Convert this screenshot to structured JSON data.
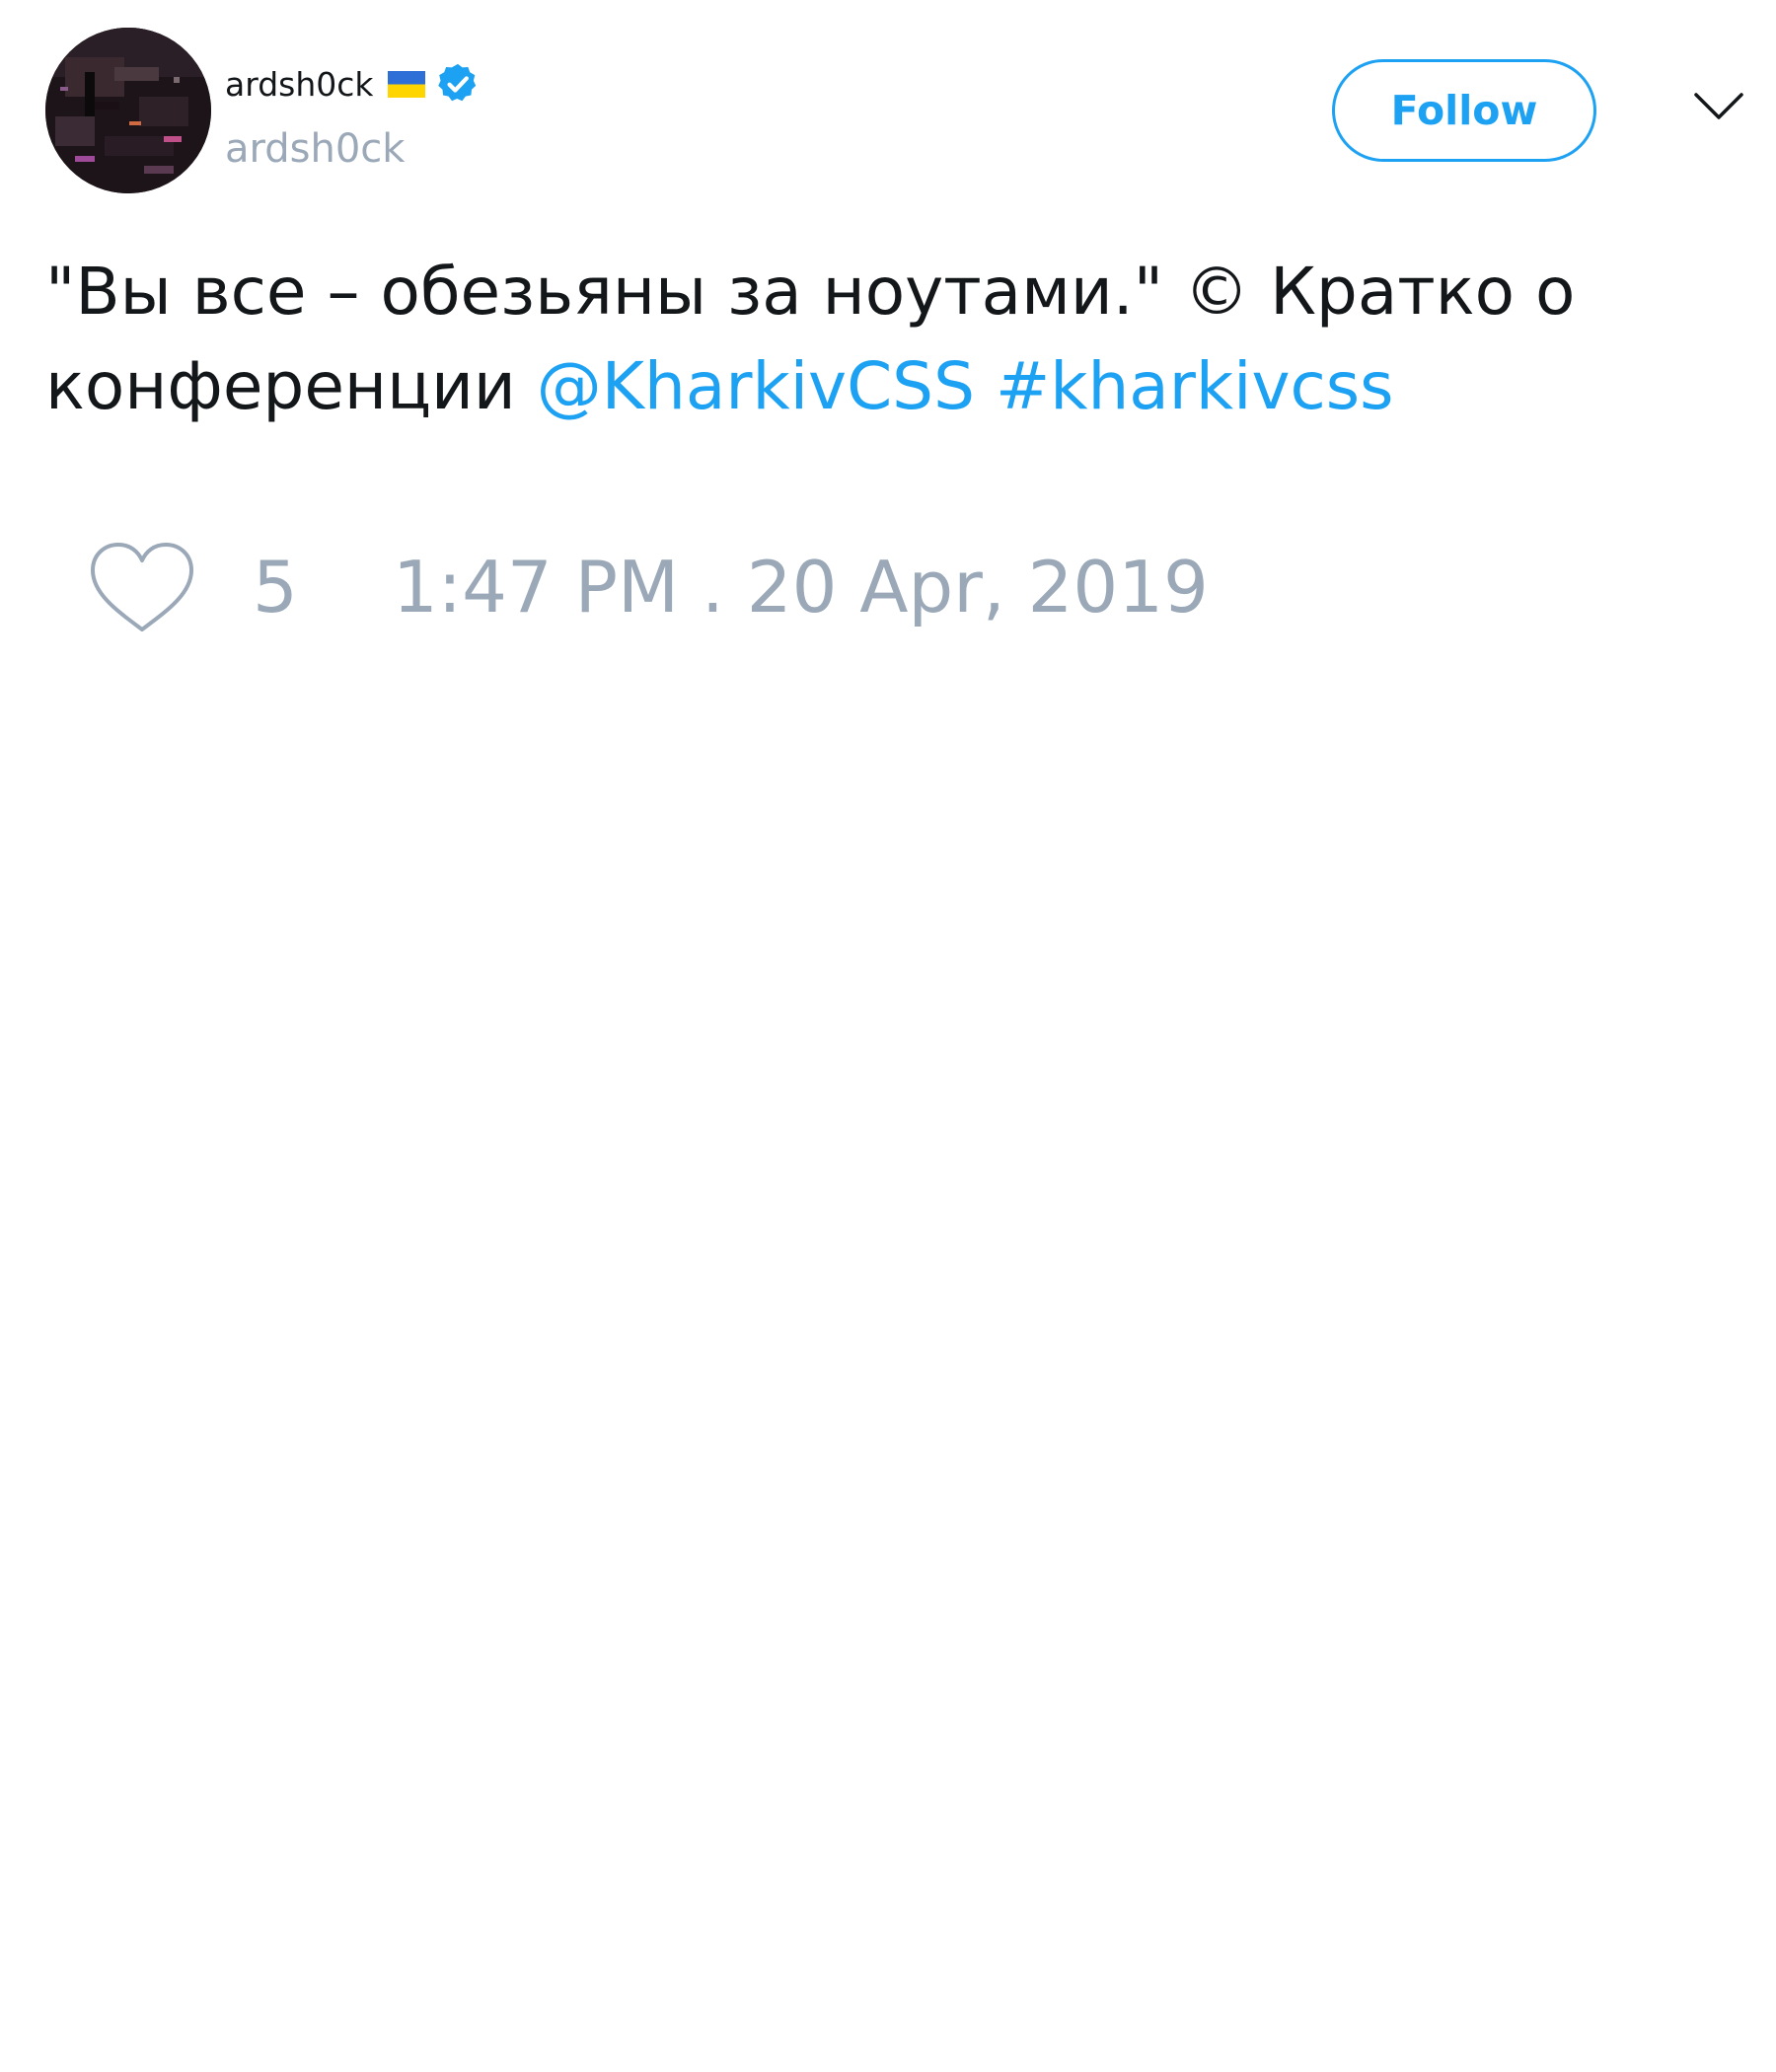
{
  "author": {
    "display_name": "ardsh0ck",
    "handle": "ardsh0ck",
    "flag": "🇺🇦",
    "flag_icon": "ukraine-flag-icon",
    "verified_icon": "verified-badge-icon",
    "avatar": "profile-photo"
  },
  "actions": {
    "follow_label": "Follow",
    "menu_icon": "chevron-down-icon"
  },
  "tweet": {
    "text_before": "\"Вы все – обезьяны за ноутами.\" © Кратко о конференции",
    "mention": "@KharkivCSS",
    "hashtag": "#kharkivcss"
  },
  "footer": {
    "like_icon": "heart-icon",
    "like_count": "5",
    "timestamp": "1:47 PM . 20 Apr, 2019"
  },
  "colors": {
    "accent": "#1da1f2",
    "text": "#14171a",
    "muted": "#9aa8b8",
    "background": "#ffffff"
  }
}
